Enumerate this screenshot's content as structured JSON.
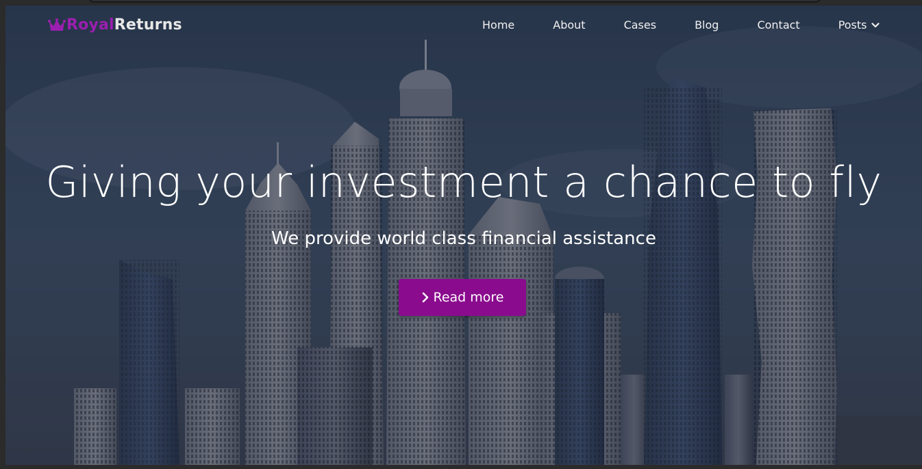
{
  "brand": {
    "part1": "Royal",
    "part2": "Returns",
    "icon": "crown-icon",
    "accent": "#9b1fb0"
  },
  "nav": {
    "items": [
      {
        "label": "Home"
      },
      {
        "label": "About"
      },
      {
        "label": "Cases"
      },
      {
        "label": "Blog"
      },
      {
        "label": "Contact"
      },
      {
        "label": "Posts",
        "icon": "chevron-down-icon"
      }
    ]
  },
  "hero": {
    "headline": "Giving your investment a chance to fly",
    "subheadline": "We provide world class financial assistance",
    "cta_label": "Read more",
    "cta_icon": "chevron-right-icon",
    "cta_color": "#8a0b8e"
  }
}
